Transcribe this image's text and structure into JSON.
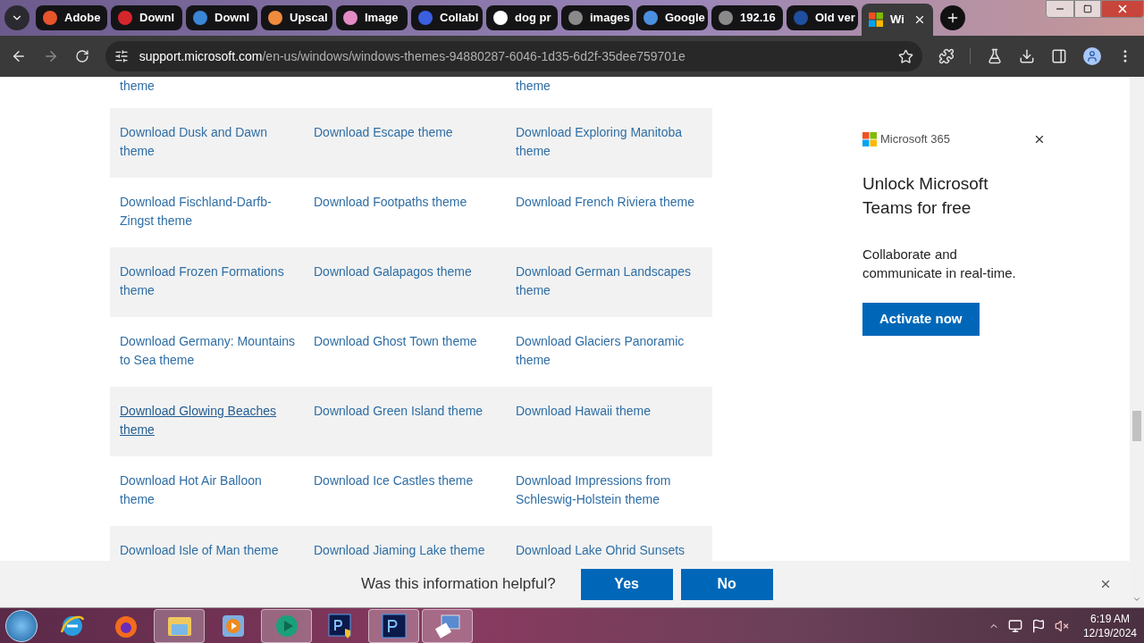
{
  "browser": {
    "tabs": [
      {
        "label": "Adobe",
        "color": "#e8542c",
        "selected": false
      },
      {
        "label": "Downl",
        "color": "#d6262b",
        "selected": false
      },
      {
        "label": "Downl",
        "color": "#3a86d6",
        "selected": false
      },
      {
        "label": "Upscal",
        "color": "#f08a3c",
        "selected": false
      },
      {
        "label": "Image",
        "color": "#e48bc4",
        "selected": false
      },
      {
        "label": "Collabl",
        "color": "#3a5fe0",
        "selected": false
      },
      {
        "label": "dog pr",
        "color": "#ffffff",
        "selected": false
      },
      {
        "label": "images",
        "color": "#8a8a8a",
        "selected": false
      },
      {
        "label": "Google",
        "color": "#4a8fe0",
        "selected": false
      },
      {
        "label": "192.16",
        "color": "#8a8a8a",
        "selected": false
      },
      {
        "label": "Old ver",
        "color": "#1f4fa0",
        "selected": false
      },
      {
        "label": "Wi",
        "selected": true
      }
    ],
    "address": {
      "host": "support.microsoft.com",
      "path": "/en-us/windows/windows-themes-94880287-6046-1d35-6d2f-35dee759701e"
    }
  },
  "theme_table": {
    "rows": [
      [
        {
          "text": "theme",
          "hovered": false
        },
        null,
        {
          "text": "theme",
          "hovered": false
        }
      ],
      [
        {
          "text": "Download Dusk and Dawn theme",
          "hovered": false
        },
        {
          "text": "Download Escape theme",
          "hovered": false
        },
        {
          "text": "Download Exploring Manitoba theme",
          "hovered": false
        }
      ],
      [
        {
          "text": "Download Fischland-Darfb-Zingst theme",
          "hovered": false
        },
        {
          "text": "Download Footpaths theme",
          "hovered": false
        },
        {
          "text": "Download French Riviera theme",
          "hovered": false
        }
      ],
      [
        {
          "text": "Download Frozen Formations theme",
          "hovered": false
        },
        {
          "text": "Download Galapagos theme",
          "hovered": false
        },
        {
          "text": "Download German Landscapes theme",
          "hovered": false
        }
      ],
      [
        {
          "text": "Download Germany: Mountains to Sea theme",
          "hovered": false
        },
        {
          "text": "Download Ghost Town theme",
          "hovered": false
        },
        {
          "text": "Download Glaciers Panoramic theme",
          "hovered": false
        }
      ],
      [
        {
          "text": "Download Glowing Beaches theme",
          "hovered": true
        },
        {
          "text": "Download Green Island theme",
          "hovered": false
        },
        {
          "text": "Download Hawaii theme",
          "hovered": false
        }
      ],
      [
        {
          "text": "Download Hot Air Balloon theme",
          "hovered": false
        },
        {
          "text": "Download Ice Castles theme",
          "hovered": false
        },
        {
          "text": "Download Impressions from Schleswig-Holstein theme",
          "hovered": false
        }
      ],
      [
        {
          "text": "Download Isle of Man theme",
          "hovered": false
        },
        {
          "text": "Download Jiaming Lake theme",
          "hovered": false
        },
        {
          "text": "Download Lake Ohrid Sunsets",
          "hovered": false
        }
      ]
    ]
  },
  "promo": {
    "brand": "Microsoft 365",
    "heading": "Unlock Microsoft Teams for free",
    "text": "Collaborate and communicate in real-time.",
    "button": "Activate now"
  },
  "feedback": {
    "question": "Was this information helpful?",
    "buttons": [
      "Yes",
      "No"
    ]
  },
  "taskbar": {
    "apps": [
      {
        "kind": "ie",
        "active": false
      },
      {
        "kind": "firefox",
        "active": false
      },
      {
        "kind": "explorer",
        "active": true
      },
      {
        "kind": "player",
        "active": false
      },
      {
        "kind": "green",
        "active": true
      },
      {
        "kind": "ps-admin",
        "active": false
      },
      {
        "kind": "ps",
        "active": true
      },
      {
        "kind": "remote",
        "active": true
      }
    ],
    "time": "6:19 AM",
    "date": "12/19/2024"
  }
}
